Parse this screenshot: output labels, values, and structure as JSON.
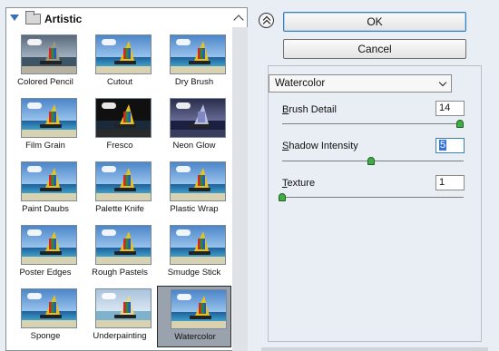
{
  "gallery": {
    "category": "Artistic",
    "thumbnails": [
      {
        "label": "Colored Pencil",
        "style": "grey"
      },
      {
        "label": "Cutout",
        "style": "normal"
      },
      {
        "label": "Dry Brush",
        "style": "normal"
      },
      {
        "label": "Film Grain",
        "style": "normal"
      },
      {
        "label": "Fresco",
        "style": "dark"
      },
      {
        "label": "Neon Glow",
        "style": "neon"
      },
      {
        "label": "Paint Daubs",
        "style": "normal"
      },
      {
        "label": "Palette Knife",
        "style": "normal"
      },
      {
        "label": "Plastic Wrap",
        "style": "normal"
      },
      {
        "label": "Poster Edges",
        "style": "normal"
      },
      {
        "label": "Rough Pastels",
        "style": "normal"
      },
      {
        "label": "Smudge Stick",
        "style": "normal"
      },
      {
        "label": "Sponge",
        "style": "normal"
      },
      {
        "label": "Underpainting",
        "style": "pale"
      },
      {
        "label": "Watercolor",
        "style": "normal",
        "selected": true
      }
    ]
  },
  "buttons": {
    "ok_label": "OK",
    "cancel_label": "Cancel"
  },
  "filter": {
    "selected": "Watercolor",
    "params": [
      {
        "label": "Brush Detail",
        "underline": "B",
        "rest": "rush Detail",
        "value": "14",
        "min": 1,
        "max": 14
      },
      {
        "label": "Shadow Intensity",
        "underline": "S",
        "rest": "hadow Intensity",
        "value": "5",
        "min": 0,
        "max": 10
      },
      {
        "label": "Texture",
        "underline": "T",
        "rest": "exture",
        "value": "1",
        "min": 1,
        "max": 3
      }
    ]
  },
  "colors": {
    "accent": "#3c7fb1",
    "slider_handle": "#3fae44",
    "selected_thumb": "#9aa3ad"
  }
}
